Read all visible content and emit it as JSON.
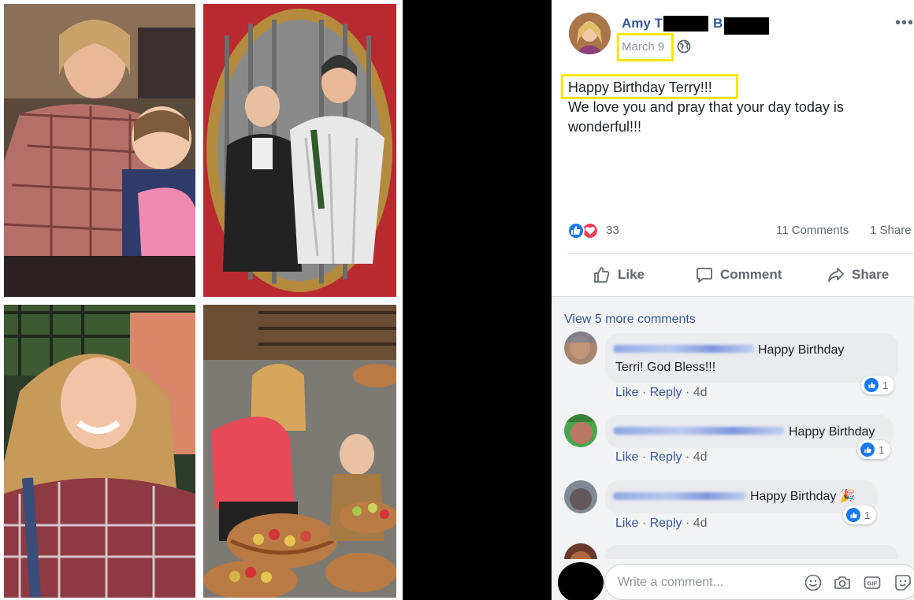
{
  "post": {
    "author_visible": "Amy T",
    "author_initial": "B",
    "date": "March 9",
    "privacy_icon": "globe-icon",
    "more_label": "•••",
    "text_line1": "Happy Birthday Terry!!!",
    "text_line2": "We love you and pray that your day today is wonderful!!!",
    "reaction_count": "33",
    "comments_count": "11 Comments",
    "shares_count": "1 Share"
  },
  "actions": {
    "like": "Like",
    "comment": "Comment",
    "share": "Share"
  },
  "comments": {
    "view_more": "View 5 more comments",
    "items": [
      {
        "text_a": "Happy Birthday",
        "text_b": "Terri! God Bless!!!",
        "like": "Like",
        "reply": "Reply",
        "time": "4d",
        "likes": "1"
      },
      {
        "text_a": "Happy Birthday",
        "like": "Like",
        "reply": "Reply",
        "time": "4d",
        "likes": "1"
      },
      {
        "text_a": "Happy Birthday 🎉",
        "like": "Like",
        "reply": "Reply",
        "time": "4d",
        "likes": "1"
      }
    ],
    "separator": "·"
  },
  "composer": {
    "placeholder": "Write a comment...",
    "icons": [
      "emoji-icon",
      "camera-icon",
      "gif-icon",
      "sticker-icon"
    ]
  },
  "colors": {
    "link": "#365899",
    "highlight": "#f6e800",
    "like_blue": "#1877f2",
    "love_red": "#f33e58"
  }
}
